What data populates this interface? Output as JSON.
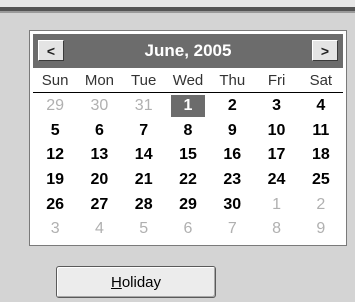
{
  "header": {
    "title": "June, 2005",
    "prev_label": "<",
    "next_label": ">"
  },
  "weekdays": [
    "Sun",
    "Mon",
    "Tue",
    "Wed",
    "Thu",
    "Fri",
    "Sat"
  ],
  "days": [
    {
      "label": "29",
      "other": true
    },
    {
      "label": "30",
      "other": true
    },
    {
      "label": "31",
      "other": true
    },
    {
      "label": "1",
      "selected": true
    },
    {
      "label": "2"
    },
    {
      "label": "3"
    },
    {
      "label": "4"
    },
    {
      "label": "5"
    },
    {
      "label": "6"
    },
    {
      "label": "7"
    },
    {
      "label": "8"
    },
    {
      "label": "9"
    },
    {
      "label": "10"
    },
    {
      "label": "11"
    },
    {
      "label": "12"
    },
    {
      "label": "13"
    },
    {
      "label": "14"
    },
    {
      "label": "15"
    },
    {
      "label": "16"
    },
    {
      "label": "17"
    },
    {
      "label": "18"
    },
    {
      "label": "19"
    },
    {
      "label": "20"
    },
    {
      "label": "21"
    },
    {
      "label": "22"
    },
    {
      "label": "23"
    },
    {
      "label": "24"
    },
    {
      "label": "25"
    },
    {
      "label": "26"
    },
    {
      "label": "27"
    },
    {
      "label": "28"
    },
    {
      "label": "29"
    },
    {
      "label": "30"
    },
    {
      "label": "1",
      "other": true
    },
    {
      "label": "2",
      "other": true
    },
    {
      "label": "3",
      "other": true
    },
    {
      "label": "4",
      "other": true
    },
    {
      "label": "5",
      "other": true
    },
    {
      "label": "6",
      "other": true
    },
    {
      "label": "7",
      "other": true
    },
    {
      "label": "8",
      "other": true
    },
    {
      "label": "9",
      "other": true
    }
  ],
  "holiday_button": {
    "mnemonic": "H",
    "rest": "oliday"
  },
  "colors": {
    "header_bg": "#6c6c6c",
    "selected_bg": "#6c6c6c",
    "other_month_text": "#b0b0b0"
  }
}
